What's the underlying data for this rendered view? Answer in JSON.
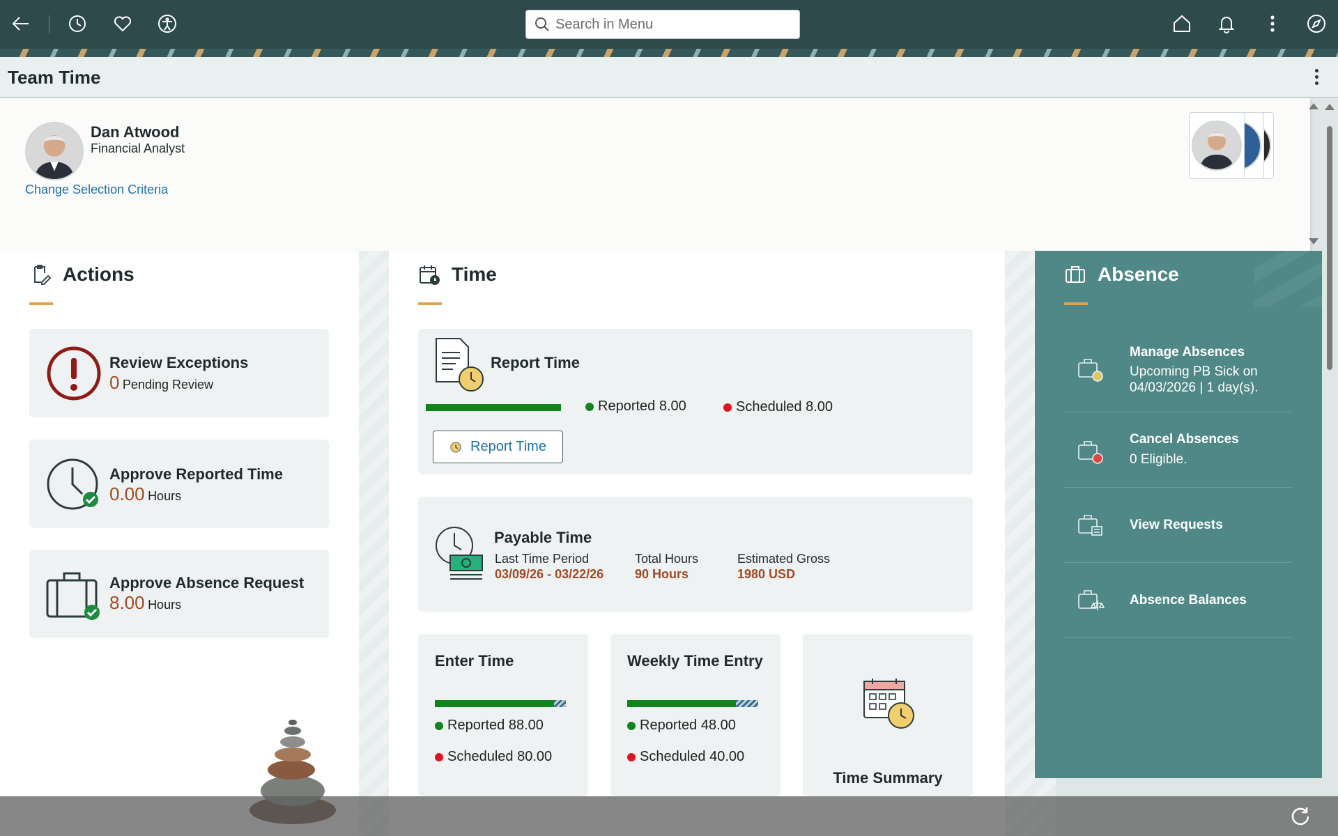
{
  "topbar": {
    "search_placeholder": "Search in Menu",
    "icons": [
      "back-arrow-icon",
      "recent-history-icon",
      "favorites-heart-icon",
      "accessibility-icon",
      "home-icon",
      "notifications-bell-icon",
      "more-actions-icon",
      "navigator-compass-icon"
    ]
  },
  "page": {
    "title": "Team Time"
  },
  "employee": {
    "name": "Dan Atwood",
    "role": "Financial Analyst",
    "change_link": "Change Selection Criteria"
  },
  "actions": {
    "heading": "Actions",
    "items": [
      {
        "title": "Review Exceptions",
        "value": "0",
        "unit": "Pending Review",
        "icon": "exception-alert-icon"
      },
      {
        "title": "Approve Reported Time",
        "value": "0.00",
        "unit": "Hours",
        "icon": "clock-approve-icon"
      },
      {
        "title": "Approve Absence Request",
        "value": "8.00",
        "unit": "Hours",
        "icon": "briefcase-approve-icon"
      }
    ]
  },
  "time": {
    "heading": "Time",
    "report": {
      "title": "Report Time",
      "reported_label": "Reported 8.00",
      "scheduled_label": "Scheduled 8.00",
      "button": "Report Time",
      "reported_fraction": 1.0
    },
    "payable": {
      "title": "Payable Time",
      "period_label": "Last Time Period",
      "period_value": "03/09/26 - 03/22/26",
      "hours_label": "Total Hours",
      "hours_value": "90 Hours",
      "gross_label": "Estimated Gross",
      "gross_value": "1980 USD"
    },
    "enter": {
      "title": "Enter Time",
      "reported_label": "Reported 88.00",
      "scheduled_label": "Scheduled 80.00",
      "reported_fraction": 0.91
    },
    "weekly": {
      "title": "Weekly Time Entry",
      "reported_label": "Reported 48.00",
      "scheduled_label": "Scheduled 40.00",
      "reported_fraction": 0.83
    },
    "summary": {
      "title": "Time Summary"
    }
  },
  "absence": {
    "heading": "Absence",
    "items": [
      {
        "title": "Manage Absences",
        "sub": "Upcoming PB Sick on 04/03/2026 | 1 day(s).",
        "icon": "manage-absences-icon"
      },
      {
        "title": "Cancel Absences",
        "sub": "0 Eligible.",
        "icon": "cancel-absences-icon"
      },
      {
        "title": "View Requests",
        "sub": "",
        "icon": "view-requests-icon"
      },
      {
        "title": "Absence Balances",
        "sub": "",
        "icon": "absence-balances-icon"
      }
    ]
  },
  "colors": {
    "topbar": "#2e4a4d",
    "accent_underline": "#e2a24d",
    "value_orange": "#a14a23",
    "reported_green": "#11841e",
    "scheduled_red": "#e0141e",
    "absence_panel": "#4f8886",
    "link_blue": "#1f6fa8"
  }
}
